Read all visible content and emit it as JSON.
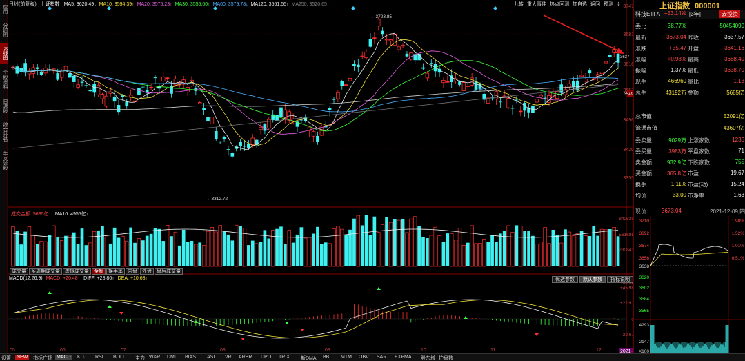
{
  "left_tabs": [
    {
      "label": "应用",
      "active": false
    },
    {
      "label": "分时图",
      "active": false
    },
    {
      "label": "K线图",
      "active": true
    },
    {
      "label": "个股资料",
      "active": false
    },
    {
      "label": "自选股",
      "active": false
    },
    {
      "label": "综合排名",
      "active": false
    },
    {
      "label": "牛叉诊股",
      "active": false
    }
  ],
  "top_legend": {
    "period": "日线(前复权)",
    "name": "上证指数",
    "items": [
      {
        "t": "MA5: 3620.49↓",
        "c": "#e8e8e8"
      },
      {
        "t": "MA10: 3594.39↑",
        "c": "#f5e23a"
      },
      {
        "t": "MA20: 3575.23↑",
        "c": "#e060e0"
      },
      {
        "t": "MA30: 3555.00↑",
        "c": "#3cff3c"
      },
      {
        "t": "MA60: 3579.78↓",
        "c": "#4ab0ff"
      },
      {
        "t": "MA120: 3551.55↑",
        "c": "#e8e8e8"
      },
      {
        "t": "MA250: 3520.65↑",
        "c": "#808080"
      }
    ]
  },
  "top_toolbar": [
    "九转",
    "重大事件",
    "热点回测",
    "加自选",
    "返回",
    "预测"
  ],
  "price_axis": [
    "3747",
    "3681",
    "3616",
    "3557",
    "3496",
    "3420",
    "3355"
  ],
  "price_axis_highlight": "3549",
  "current_label": "3637",
  "annotations": {
    "high": "3723.85",
    "low": "3312.72"
  },
  "volume_legend": {
    "main": "成交金额: 5685亿↑",
    "ma10": "MA10: 4955亿↑"
  },
  "volume_axis": [
    "842529",
    "561686",
    "280843"
  ],
  "volume_tabs": [
    "成交量",
    "多周期成交量",
    "虚拟成交量",
    "金额",
    "换手率",
    "内盘",
    "外盘",
    "盘后成交量"
  ],
  "volume_tab_active": 3,
  "macd_legend": {
    "title": "MACD(12,26,9)",
    "macd": "MACD: +20.48↑",
    "diff": "DIFF: +28.86↑",
    "dea": "DEA: +10.63↑"
  },
  "macd_buttons": [
    "优选参数",
    "默认参数",
    "指标说明"
  ],
  "macd_button_active": 1,
  "macd_axis": [
    "+53.12",
    "+45.98",
    "+22.91",
    "0",
    "-22.67"
  ],
  "month_labels": [
    "05",
    "06",
    "07",
    "08",
    "09",
    "10",
    "11",
    "12"
  ],
  "date_badge": "2021-12-09/四",
  "stock_header": {
    "name": "上证指数",
    "code": "000001"
  },
  "etf_row": {
    "name": "科技ETFA",
    "value": "+53.14%",
    "tag": "[3年]",
    "button": "去投资"
  },
  "quote_rows": [
    {
      "l1": "委比",
      "v1": "-38.77%",
      "c1": "#3cff3c",
      "l2": "",
      "v2": "-50454090",
      "c2": "#3cff3c"
    },
    {
      "l1": "最新",
      "v1": "3673.04",
      "c1": "#ff4a4a",
      "l2": "昨收",
      "v2": "3637.57",
      "c2": "#eee"
    },
    {
      "l1": "涨跌",
      "v1": "+35.47",
      "c1": "#ff4a4a",
      "l2": "开盘",
      "v2": "3641.16",
      "c2": "#ff4a4a"
    },
    {
      "l1": "涨幅",
      "v1": "+0.98%",
      "c1": "#ff4a4a",
      "l2": "最高",
      "v2": "3688.40",
      "c2": "#ff4a4a"
    },
    {
      "l1": "振幅",
      "v1": "1.37%",
      "c1": "#eee",
      "l2": "最低",
      "v2": "3638.70",
      "c2": "#ff4a4a"
    },
    {
      "l1": "现手",
      "v1": "466960",
      "c1": "#f5e23a",
      "l2": "量比",
      "v2": "1.13",
      "c2": "#ff4a4a"
    },
    {
      "l1": "总手",
      "v1": "43192万",
      "c1": "#f5e23a",
      "l2": "金额",
      "v2": "5685亿",
      "c2": "#f5e23a"
    }
  ],
  "cap_rows": [
    {
      "l": "总市值",
      "v": "52091亿"
    },
    {
      "l": "流通市值",
      "v": "43607亿"
    }
  ],
  "order_rows": [
    {
      "l1": "委卖量",
      "v1": "9029万",
      "c1": "#3cff3c",
      "l2": "上涨家数",
      "v2": "1236",
      "c2": "#ff4a4a"
    },
    {
      "l1": "委买量",
      "v1": "3983万",
      "c1": "#ff4a4a",
      "l2": "平盘家数",
      "v2": "71",
      "c2": "#eee"
    },
    {
      "l1": "卖金额",
      "v1": "932.9亿",
      "c1": "#3cff3c",
      "l2": "下跌家数",
      "v2": "755",
      "c2": "#3cff3c"
    },
    {
      "l1": "买金额",
      "v1": "365.8亿",
      "c1": "#ff4a4a",
      "l2": "市盈",
      "v2": "19.67",
      "c2": "#eee"
    },
    {
      "l1": "换手",
      "v1": "1.11%",
      "c1": "#f5e23a",
      "l2": "市盈(动)",
      "v2": "15.24",
      "c2": "#eee"
    },
    {
      "l1": "均价",
      "v1": "33.00",
      "c1": "#f5e23a",
      "l2": "市净率",
      "v2": "1.63",
      "c2": "#eee"
    }
  ],
  "mini_header": {
    "label": "现价",
    "price": "3673.04",
    "date": "2021-12-09,四"
  },
  "mini_left_axis": [
    "3710",
    "3692",
    "3674",
    "3656",
    "3638",
    "3620",
    "3602",
    "3584",
    "3565"
  ],
  "mini_right_axis": [
    "1.98%",
    "1.52%",
    "1.01%",
    "0.51%"
  ],
  "mini_volume_axis": [
    "4293",
    "2147",
    "X100"
  ],
  "mini_tabs": [
    "分",
    "日"
  ],
  "bottom_tabs": [
    "设置",
    "NEW",
    "指标广场",
    "MACD",
    "KDJ",
    "RSI",
    "BOLL",
    "主力",
    "W&R",
    "DMI",
    "BIAS",
    "ASI",
    "VR",
    "ARBR",
    "DPO",
    "TRIX",
    "新DMA",
    "BBI",
    "MTM",
    "OBV",
    "SAR",
    "EXPMA",
    "股东增",
    "护盘数"
  ],
  "bottom_active": 3,
  "chart_data": {
    "type": "candlestick",
    "ohlc": [],
    "note_source": "close values visible on price axis"
  },
  "colors": {
    "up": "#ff3030",
    "down": "#3ef0f0",
    "bg": "#000000",
    "accent": "#8a0000"
  }
}
